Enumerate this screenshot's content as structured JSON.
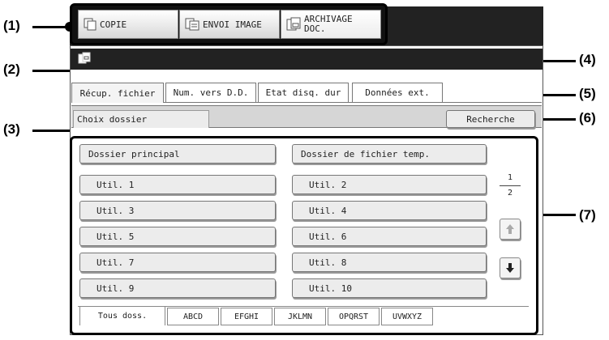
{
  "callouts": [
    "(1)",
    "(2)",
    "(3)",
    "(4)",
    "(5)",
    "(6)",
    "(7)"
  ],
  "mode_buttons": [
    {
      "label": "COPIE",
      "icon": "copy-icon"
    },
    {
      "label": "ENVOI IMAGE",
      "icon": "send-image-icon"
    },
    {
      "label": "ARCHIVAGE DOC.",
      "icon": "archive-icon"
    }
  ],
  "header_icon": "document-filing-icon",
  "tabs": [
    "Récup. fichier",
    "Num. vers D.D.",
    "Etat disq. dur",
    "Données ext."
  ],
  "folder_bar": {
    "label": "Choix dossier",
    "search_button": "Recherche"
  },
  "folders": {
    "main": "Dossier principal",
    "temp": "Dossier de fichier temp.",
    "users_left": [
      "Util. 1",
      "Util. 3",
      "Util. 5",
      "Util. 7",
      "Util. 9"
    ],
    "users_right": [
      "Util. 2",
      "Util. 4",
      "Util. 6",
      "Util. 8",
      "Util. 10"
    ]
  },
  "pager": {
    "current": "1",
    "total": "2"
  },
  "filter_tabs": [
    "Tous doss.",
    "ABCD",
    "EFGHI",
    "JKLMN",
    "OPQRST",
    "UVWXYZ"
  ]
}
